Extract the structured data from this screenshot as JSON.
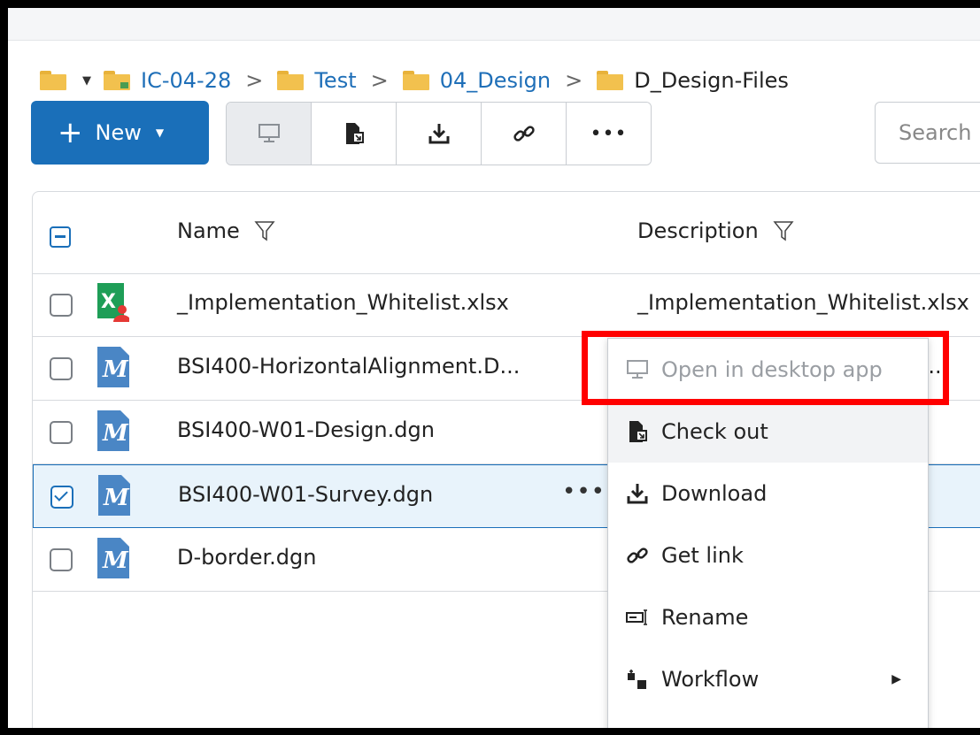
{
  "breadcrumb": {
    "items": [
      "IC-04-28",
      "Test",
      "04_Design",
      "D_Design-Files"
    ],
    "separator": ">"
  },
  "toolbar": {
    "new_label": "New",
    "search_placeholder": "Search"
  },
  "table": {
    "columns": [
      "Name",
      "Description"
    ],
    "rows": [
      {
        "name": "_Implementation_Whitelist.xlsx",
        "description": "_Implementation_Whitelist.xlsx",
        "type": "excel",
        "checked": false
      },
      {
        "name": "BSI400-HorizontalAlignment.D...",
        "description": "nt.D...",
        "type": "microstation",
        "checked": false
      },
      {
        "name": "BSI400-W01-Design.dgn",
        "description": "",
        "type": "microstation",
        "checked": false
      },
      {
        "name": "BSI400-W01-Survey.dgn",
        "description": "",
        "type": "microstation",
        "checked": true
      },
      {
        "name": "D-border.dgn",
        "description": "",
        "type": "microstation",
        "checked": false
      }
    ],
    "row_more": "•••"
  },
  "context_menu": {
    "items": [
      {
        "label": "Open in desktop app",
        "icon": "monitor-icon",
        "disabled": true
      },
      {
        "label": "Check out",
        "icon": "check-out-icon",
        "disabled": false
      },
      {
        "label": "Download",
        "icon": "download-icon",
        "disabled": false
      },
      {
        "label": "Get link",
        "icon": "link-icon",
        "disabled": false
      },
      {
        "label": "Rename",
        "icon": "rename-icon",
        "disabled": false
      },
      {
        "label": "Workflow",
        "icon": "workflow-icon",
        "disabled": false
      }
    ]
  },
  "colors": {
    "accent": "#1a6fb9",
    "highlight": "#ff0000",
    "folder": "#f2c14e"
  }
}
